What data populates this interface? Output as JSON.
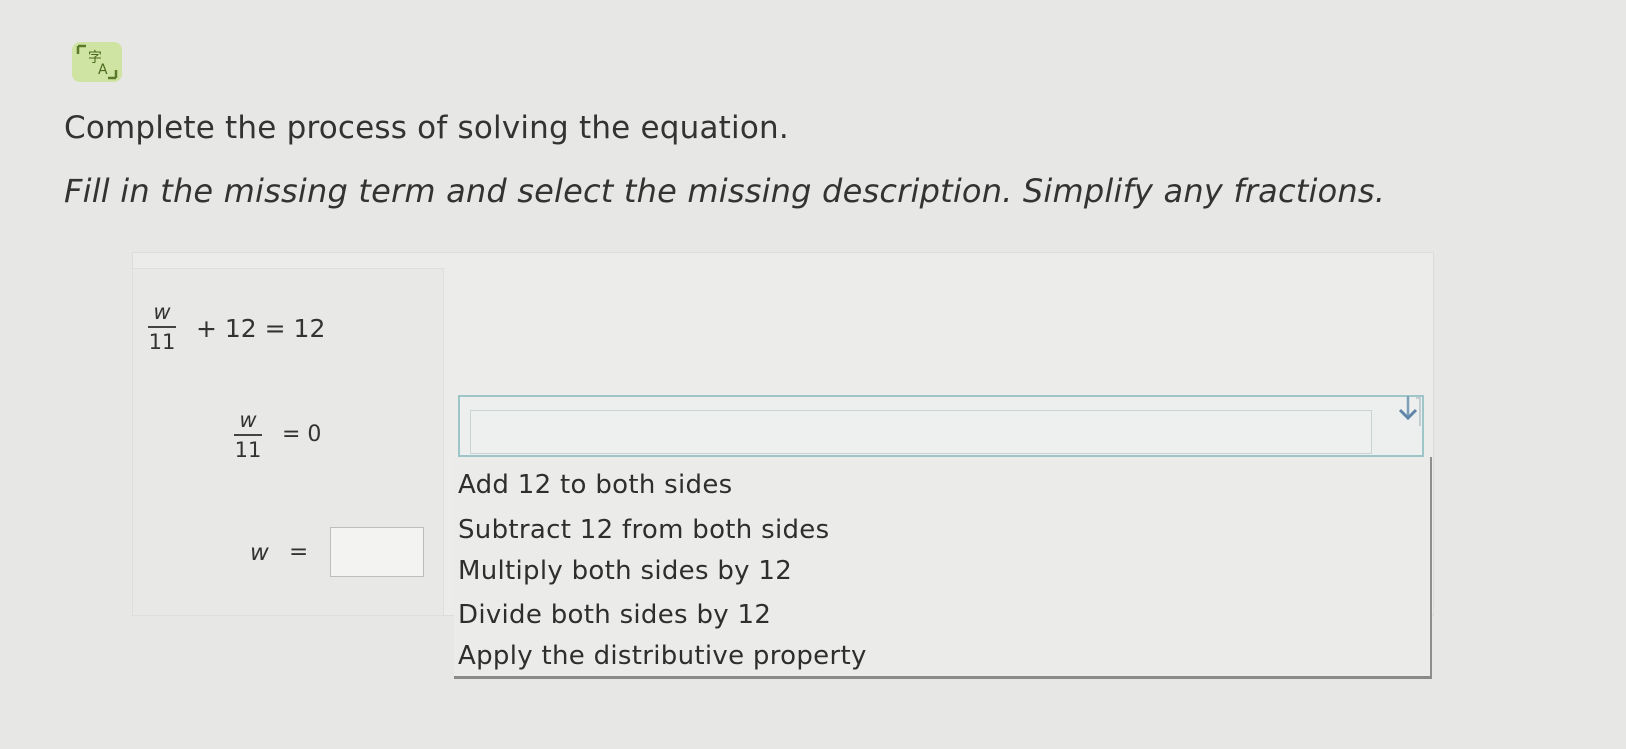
{
  "header": {
    "icon": "translate-icon",
    "instruction": "Complete the process of solving the equation.",
    "subinstruction": "Fill in the missing term and select the missing description. Simplify any fractions."
  },
  "steps": {
    "step1": {
      "numerator": "w",
      "denominator": "11",
      "rest": "+ 12 = 12"
    },
    "step2": {
      "numerator": "w",
      "denominator": "11",
      "rest": "= 0"
    },
    "step3": {
      "variable": "w",
      "equals": "=",
      "answer": ""
    }
  },
  "description_select": {
    "selected": "",
    "options": [
      "Add 12 to both sides",
      "Subtract 12 from both sides",
      "Multiply both sides by 12",
      "Divide both sides by 12",
      "Apply the distributive property"
    ]
  }
}
